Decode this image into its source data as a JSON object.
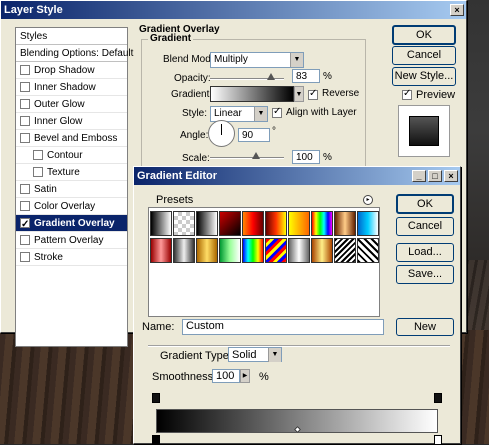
{
  "layer_style": {
    "title": "Layer Style",
    "styles_list": [
      {
        "label": "Styles",
        "type": "head"
      },
      {
        "label": "Blending Options: Default",
        "type": "head"
      },
      {
        "label": "Drop Shadow",
        "checked": false
      },
      {
        "label": "Inner Shadow",
        "checked": false
      },
      {
        "label": "Outer Glow",
        "checked": false
      },
      {
        "label": "Inner Glow",
        "checked": false
      },
      {
        "label": "Bevel and Emboss",
        "checked": false
      },
      {
        "label": "Contour",
        "checked": false,
        "indent": true
      },
      {
        "label": "Texture",
        "checked": false,
        "indent": true
      },
      {
        "label": "Satin",
        "checked": false
      },
      {
        "label": "Color Overlay",
        "checked": false
      },
      {
        "label": "Gradient Overlay",
        "checked": true,
        "selected": true
      },
      {
        "label": "Pattern Overlay",
        "checked": false
      },
      {
        "label": "Stroke",
        "checked": false
      }
    ],
    "section_title": "Gradient Overlay",
    "group_title": "Gradient",
    "blend_mode_label": "Blend Mode:",
    "blend_mode_value": "Multiply",
    "opacity_label": "Opacity:",
    "opacity_value": "83",
    "opacity_unit": "%",
    "opacity_fraction": 0.83,
    "gradient_label": "Gradient:",
    "reverse_label": "Reverse",
    "style_label": "Style:",
    "style_value": "Linear",
    "align_label": "Align with Layer",
    "angle_label": "Angle:",
    "angle_value": "90",
    "angle_unit": "°",
    "scale_label": "Scale:",
    "scale_value": "100",
    "scale_unit": "%",
    "ok_label": "OK",
    "cancel_label": "Cancel",
    "new_style_label": "New Style...",
    "preview_label": "Preview"
  },
  "gradient_editor": {
    "title": "Gradient Editor",
    "presets_label": "Presets",
    "ok_label": "OK",
    "cancel_label": "Cancel",
    "load_label": "Load...",
    "save_label": "Save...",
    "name_label": "Name:",
    "name_value": "Custom",
    "new_label": "New",
    "gradient_type_label": "Gradient Type:",
    "gradient_type_value": "Solid",
    "smoothness_label": "Smoothness:",
    "smoothness_value": "100",
    "smoothness_unit": "%"
  },
  "colors": {
    "title_start": "#0a246a",
    "title_end": "#a6caf0",
    "selected_row": "#0a246a"
  }
}
